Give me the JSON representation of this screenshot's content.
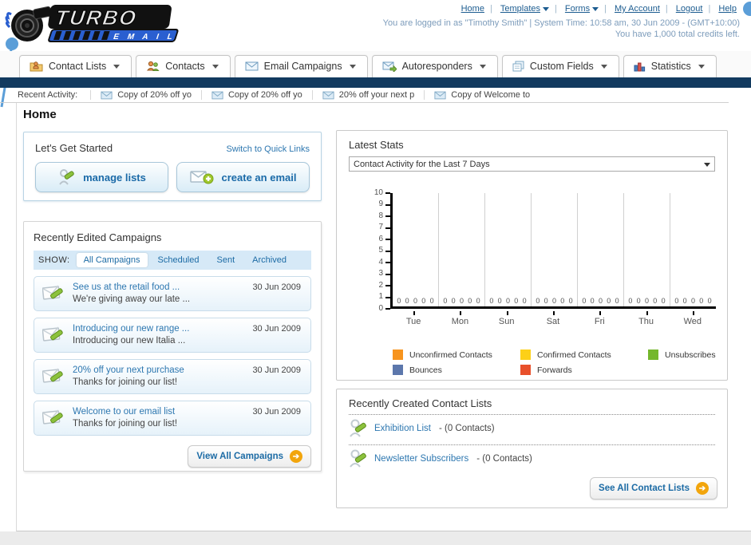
{
  "colors": {
    "navy_bar": "#123a5f",
    "link_blue": "#1c5c90",
    "accent_blue": "#2d77b0",
    "button_text_blue": "#1a6aa8",
    "show_bar_bg": "#d6e9f7",
    "orange_arrow": "#f2a50c",
    "callout_blue": "#5b9ed8"
  },
  "header": {
    "logo_line1": "TURBO",
    "logo_line2": "E M A I L",
    "nav": [
      {
        "label": "Home",
        "dropdown": false
      },
      {
        "label": "Templates",
        "dropdown": true
      },
      {
        "label": "Forms",
        "dropdown": true
      },
      {
        "label": "My Account",
        "dropdown": false
      },
      {
        "label": "Logout",
        "dropdown": false
      },
      {
        "label": "Help",
        "dropdown": false
      }
    ],
    "login_info": "You are logged in as \"Timothy Smith\" | System Time: 10:58 am, 30 Jun 2009 - (GMT+10:00)",
    "credits_info": "You have 1,000 total credits left."
  },
  "main_nav": {
    "tabs": [
      {
        "label": "Contact Lists"
      },
      {
        "label": "Contacts"
      },
      {
        "label": "Email Campaigns"
      },
      {
        "label": "Autoresponders"
      },
      {
        "label": "Custom Fields"
      },
      {
        "label": "Statistics"
      }
    ]
  },
  "recent_activity": {
    "label": "Recent Activity:",
    "items": [
      {
        "text": "Copy of 20% off yo"
      },
      {
        "text": "Copy of 20% off yo"
      },
      {
        "text": "20% off your next p"
      },
      {
        "text": "Copy of Welcome to"
      }
    ]
  },
  "page_title": "Home",
  "get_started": {
    "title": "Let's Get Started",
    "switch_link": "Switch to Quick Links",
    "manage_lists_label": "manage lists",
    "create_email_label": "create an email"
  },
  "campaigns": {
    "title": "Recently Edited Campaigns",
    "show_label": "SHOW:",
    "filters": [
      {
        "label": "All Campaigns"
      },
      {
        "label": "Scheduled"
      },
      {
        "label": "Sent"
      },
      {
        "label": "Archived"
      }
    ],
    "active_filter": "All Campaigns",
    "items": [
      {
        "title": "See us at the retail food ...",
        "subtitle": "We're giving away our late ...",
        "date": "30 Jun 2009"
      },
      {
        "title": "Introducing our new range ...",
        "subtitle": "Introducing our new Italia ...",
        "date": "30 Jun 2009"
      },
      {
        "title": "20% off your next purchase",
        "subtitle": "Thanks for joining our list!",
        "date": "30 Jun 2009"
      },
      {
        "title": "Welcome to our email list",
        "subtitle": "Thanks for joining our list!",
        "date": "30 Jun 2009"
      }
    ],
    "view_all_label": "View All Campaigns"
  },
  "latest_stats": {
    "title": "Latest Stats",
    "dropdown_value": "Contact Activity for the Last 7 Days"
  },
  "chart_data": {
    "type": "bar",
    "title": "Contact Activity for the Last 7 Days",
    "categories": [
      "Tue",
      "Mon",
      "Sun",
      "Sat",
      "Fri",
      "Thu",
      "Wed"
    ],
    "series": [
      {
        "name": "Unconfirmed Contacts",
        "color": "#f7941e",
        "values": [
          0,
          0,
          0,
          0,
          0,
          0,
          0
        ]
      },
      {
        "name": "Confirmed Contacts",
        "color": "#fdd017",
        "values": [
          0,
          0,
          0,
          0,
          0,
          0,
          0
        ]
      },
      {
        "name": "Unsubscribes",
        "color": "#74b72c",
        "values": [
          0,
          0,
          0,
          0,
          0,
          0,
          0
        ]
      },
      {
        "name": "Bounces",
        "color": "#5c77ac",
        "values": [
          0,
          0,
          0,
          0,
          0,
          0,
          0
        ]
      },
      {
        "name": "Forwards",
        "color": "#e8502b",
        "values": [
          0,
          0,
          0,
          0,
          0,
          0,
          0
        ]
      }
    ],
    "ylim": [
      0,
      10
    ],
    "yticks": [
      0,
      1,
      2,
      3,
      4,
      5,
      6,
      7,
      8,
      9,
      10
    ],
    "grid": "vertical-only",
    "legend_position": "bottom"
  },
  "contact_lists": {
    "title": "Recently Created Contact Lists",
    "items": [
      {
        "name": "Exhibition List",
        "detail": "- (0 Contacts)"
      },
      {
        "name": "Newsletter Subscribers",
        "detail": "- (0 Contacts)"
      }
    ],
    "see_all_label": "See All Contact Lists"
  }
}
